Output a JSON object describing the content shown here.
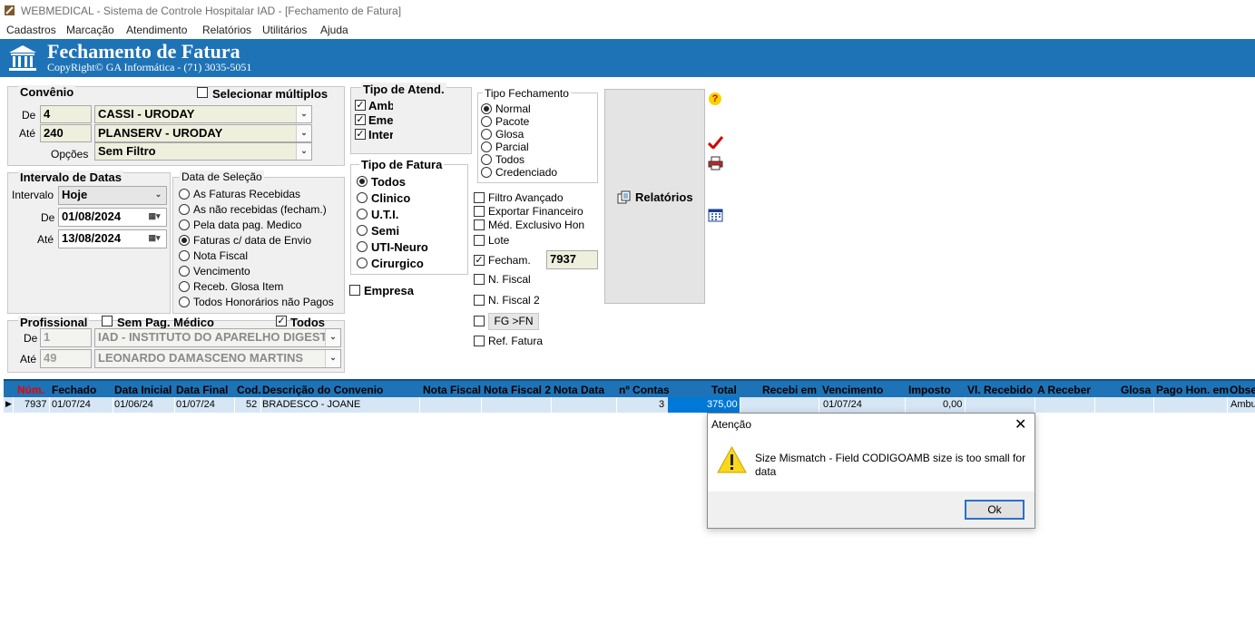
{
  "window": {
    "title": "WEBMEDICAL - Sistema de Controle Hospitalar IAD - [Fechamento de Fatura]"
  },
  "menu": [
    "Cadastros",
    "Marcação",
    "Atendimento",
    "Relatórios",
    "Utilitários",
    "Ajuda"
  ],
  "banner": {
    "title": "Fechamento de Fatura",
    "subtitle": "CopyRight© GA Informática - (71) 3035-5051"
  },
  "convenio": {
    "label": "Convênio",
    "multi_label": "Selecionar múltiplos",
    "de_label": "De",
    "de_code": "4",
    "de_name": "CASSI - URODAY",
    "ate_label": "Até",
    "ate_code": "240",
    "ate_name": "PLANSERV - URODAY",
    "opcoes_label": "Opções",
    "opcoes_value": "Sem Filtro"
  },
  "intervalo": {
    "label": "Intervalo de Datas",
    "intervalo_label": "Intervalo",
    "intervalo_value": "Hoje",
    "de_label": "De",
    "de_value": "01/08/2024",
    "ate_label": "Até",
    "ate_value": "13/08/2024"
  },
  "data_selecao": {
    "label": "Data de Seleção",
    "options": [
      "As Faturas Recebidas",
      "As não recebidas (fecham.)",
      "Pela data pag. Medico",
      "Faturas c/ data de Envio",
      "Nota Fiscal",
      "Vencimento",
      "Receb. Glosa Item",
      "Todos Honorários não Pagos"
    ]
  },
  "profissional": {
    "label": "Profissional",
    "sem_pag_label": "Sem Pag. Médico",
    "todos_label": "Todos",
    "de_label": "De",
    "de_code": "1",
    "de_name": "IAD - INSTITUTO DO APARELHO DIGEST",
    "ate_label": "Até",
    "ate_code": "49",
    "ate_name": "LEONARDO DAMASCENO MARTINS"
  },
  "tipo_atend": {
    "label": "Tipo de Atend.",
    "options": [
      "Amb",
      "Eme",
      "Inter"
    ]
  },
  "tipo_fatura": {
    "label": "Tipo de Fatura",
    "options": [
      "Todos",
      "Clinico",
      "U.T.I.",
      "Semi",
      "UTI-Neuro",
      "Cirurgico"
    ]
  },
  "empresa_label": "Empresa",
  "tipo_fechamento": {
    "label": "Tipo Fechamento",
    "options": [
      "Normal",
      "Pacote",
      "Glosa",
      "Parcial",
      "Todos",
      "Credenciado"
    ]
  },
  "filtros": {
    "filtro_avancado": "Filtro Avançado",
    "exportar_financeiro": "Exportar Financeiro",
    "med_exclusivo": "Méd. Exclusivo Hon",
    "lote": "Lote",
    "fecham": "Fecham.",
    "fecham_value": "7937",
    "n_fiscal": "N. Fiscal",
    "n_fiscal_2": "N. Fiscal 2",
    "fg_fn": "FG >FN",
    "ref_fatura": "Ref. Fatura"
  },
  "relatorios_label": "Relatórios",
  "grid": {
    "headers": [
      "Núm.",
      "Fechado",
      "Data Inicial",
      "Data Final",
      "Cod.",
      "Descrição do Convenio",
      "Nota Fiscal",
      "Nota Fiscal 2",
      "Nota Data",
      "nº Contas",
      "Total",
      "Recebi em",
      "Vencimento",
      "Imposto",
      "Vl. Recebido",
      "A Receber",
      "Glosa",
      "Pago Hon. em",
      "Obse"
    ],
    "row": {
      "num": "7937",
      "fechado": "01/07/24",
      "data_inicial": "01/06/24",
      "data_final": "01/07/24",
      "cod": "52",
      "descricao": "BRADESCO - JOANE",
      "contas": "3",
      "total": "375,00",
      "vencimento": "01/07/24",
      "imposto": "0,00",
      "obse": "Ambu"
    }
  },
  "dialog": {
    "title": "Atenção",
    "message_line1": "Size Mismatch - Field CODIGOAMB size is too small for",
    "message_line2": "data",
    "ok_label": "Ok"
  },
  "colors": {
    "banner": "#1e73b6",
    "grid_header": "#1e73b6",
    "selected_cell": "#0078d7",
    "field_bg": "#efefdd"
  }
}
